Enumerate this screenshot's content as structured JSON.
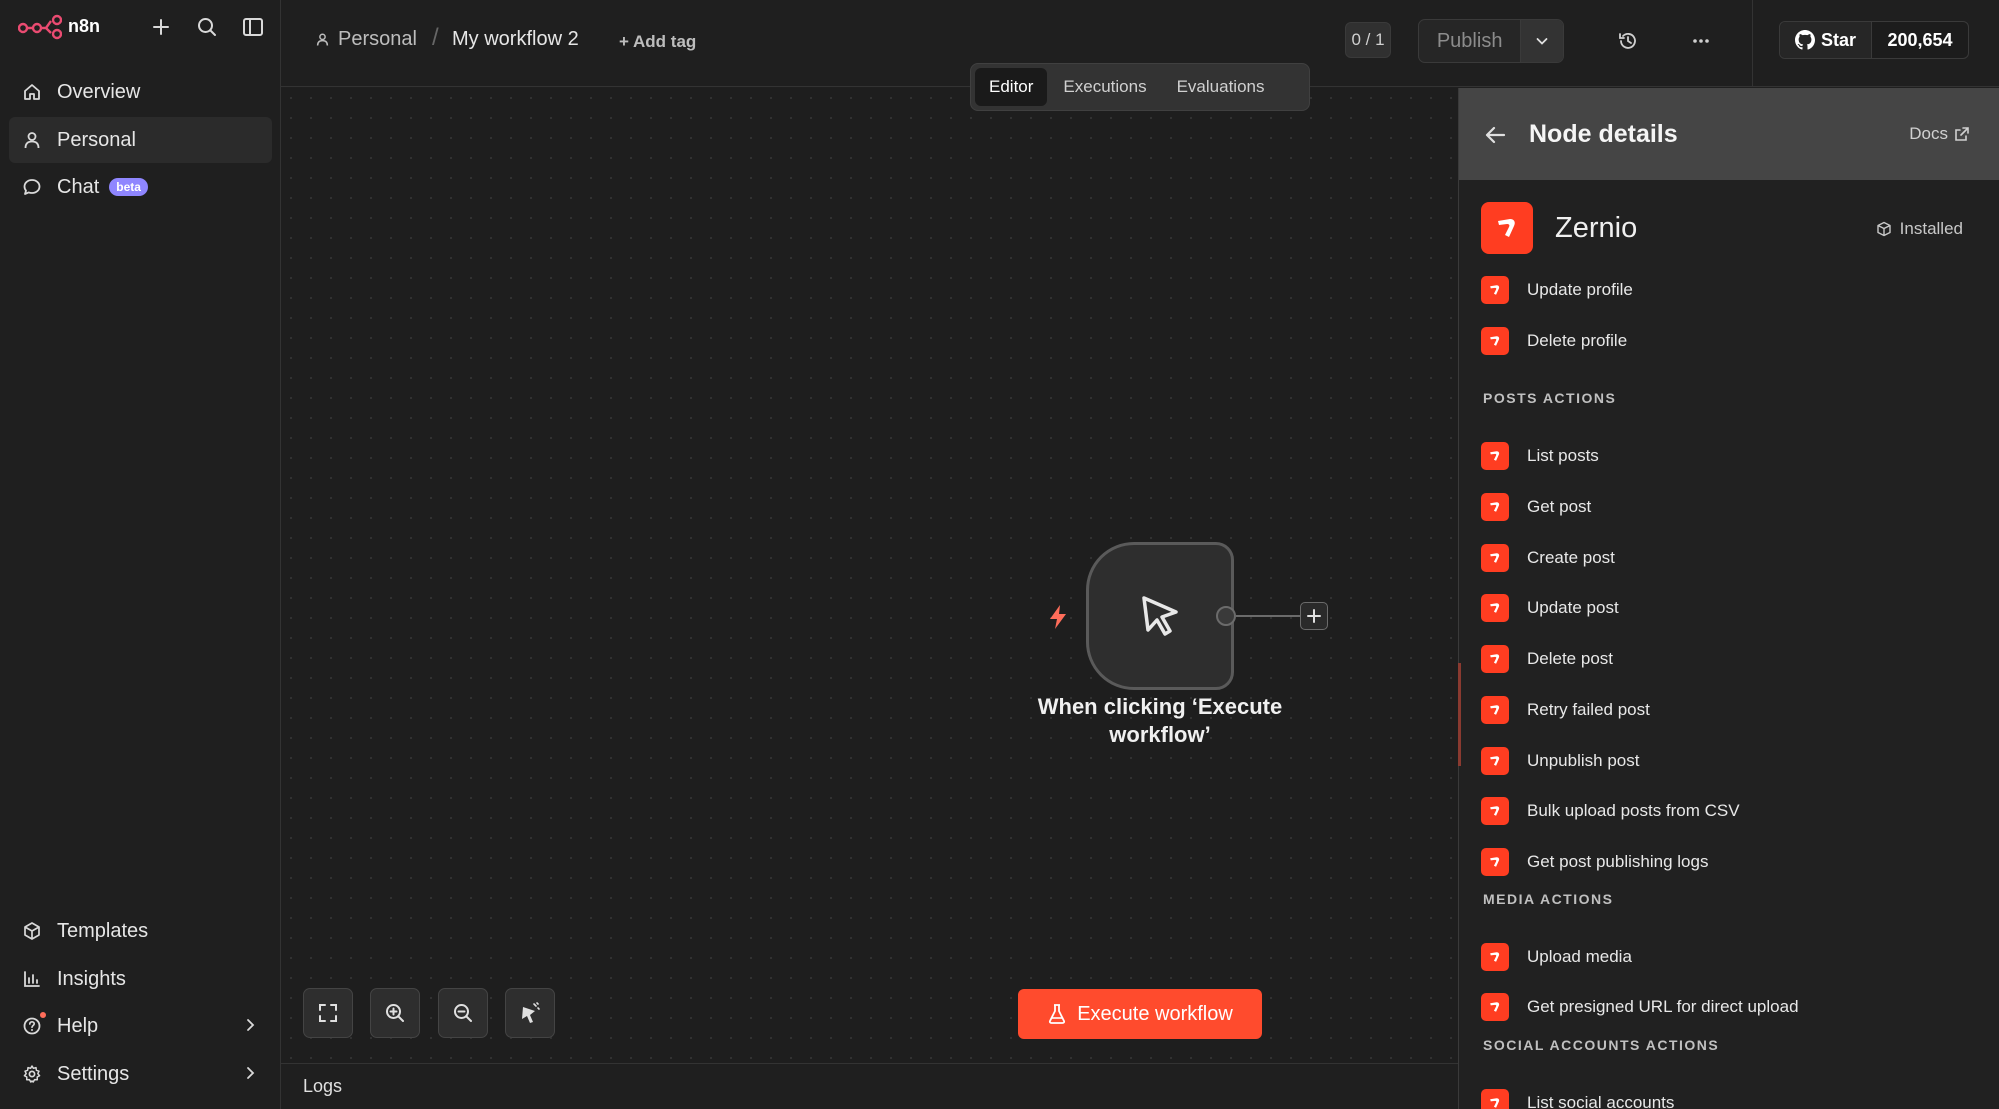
{
  "app": {
    "logo_text": "n8n"
  },
  "sidebar": {
    "nav": [
      {
        "label": "Overview",
        "icon": "home-icon"
      },
      {
        "label": "Personal",
        "icon": "user-icon",
        "active": true
      },
      {
        "label": "Chat",
        "icon": "chat-icon",
        "badge": "beta"
      }
    ],
    "bottom": [
      {
        "label": "Templates",
        "icon": "templates-icon"
      },
      {
        "label": "Insights",
        "icon": "chart-icon"
      },
      {
        "label": "Help",
        "icon": "help-icon"
      },
      {
        "label": "Settings",
        "icon": "gear-icon"
      }
    ]
  },
  "header": {
    "breadcrumb_project": "Personal",
    "breadcrumb_separator": "/",
    "workflow_name": "My workflow 2",
    "add_tag": "+ Add tag",
    "counter": "0 / 1",
    "publish": "Publish",
    "github_star": "Star",
    "github_count": "200,654"
  },
  "tabs": [
    {
      "label": "Editor",
      "active": true
    },
    {
      "label": "Executions"
    },
    {
      "label": "Evaluations"
    }
  ],
  "canvas": {
    "node_label": "When clicking ‘Execute workflow’",
    "execute_button": "Execute workflow"
  },
  "logs": {
    "label": "Logs"
  },
  "panel": {
    "title": "Node details",
    "docs": "Docs",
    "node_name": "Zernio",
    "installed": "Installed",
    "profile_actions": [
      "Update profile",
      "Delete profile"
    ],
    "posts_title": "POSTS ACTIONS",
    "posts_actions": [
      "List posts",
      "Get post",
      "Create post",
      "Update post",
      "Delete post",
      "Retry failed post",
      "Unpublish post",
      "Bulk upload posts from CSV",
      "Get post publishing logs"
    ],
    "media_title": "MEDIA ACTIONS",
    "media_actions": [
      "Upload media",
      "Get presigned URL for direct upload"
    ],
    "social_title": "SOCIAL ACCOUNTS ACTIONS",
    "social_actions": [
      "List social accounts"
    ]
  },
  "colors": {
    "accent": "#ff4b2d",
    "zernio": "#ff3d21",
    "badge": "#8f86ff",
    "background": "#1f1f1f"
  }
}
